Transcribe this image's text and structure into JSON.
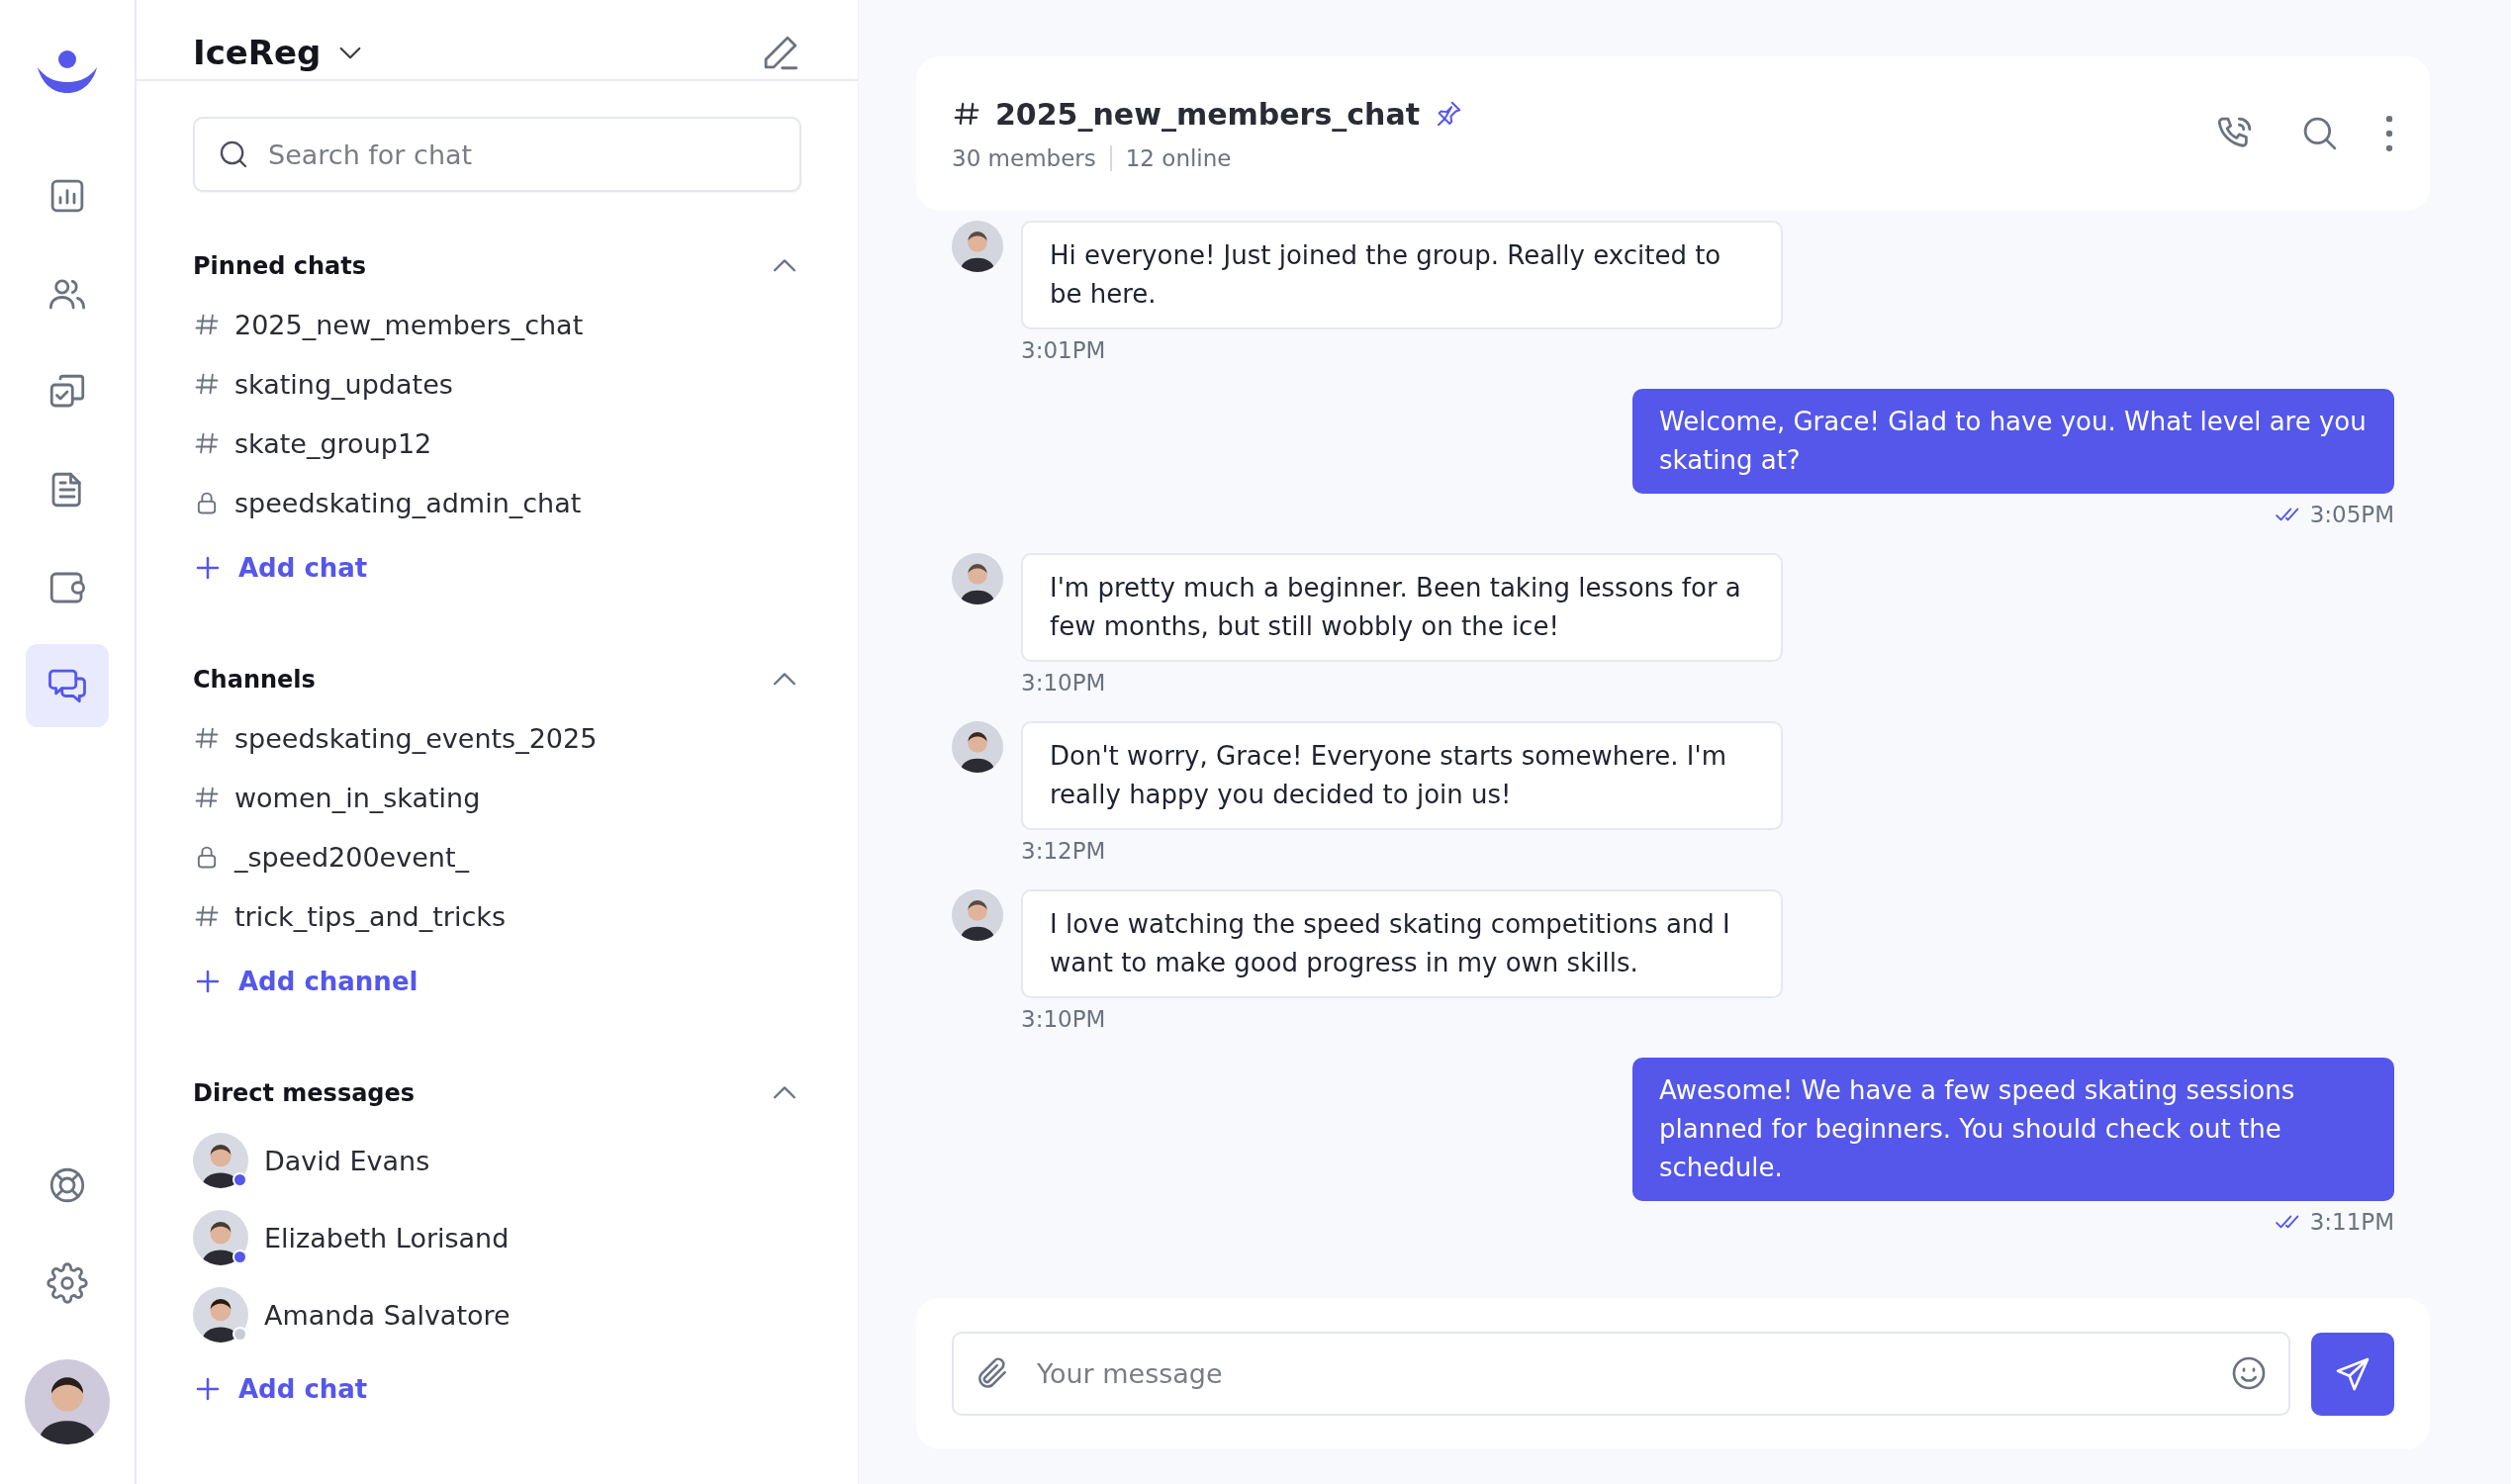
{
  "rail": [
    {
      "kind": "analytics",
      "selected": false
    },
    {
      "kind": "people",
      "selected": false
    },
    {
      "kind": "tasks",
      "selected": false
    },
    {
      "kind": "document",
      "selected": false
    },
    {
      "kind": "wallet",
      "selected": false
    },
    {
      "kind": "chat",
      "selected": true
    }
  ],
  "rail_bottom": [
    {
      "kind": "support"
    },
    {
      "kind": "settings"
    }
  ],
  "sidebar": {
    "workspace": "IceReg",
    "search": {
      "placeholder": "Search for chat"
    },
    "sections": [
      {
        "title": "Pinned chats",
        "expanded": true,
        "add_label": "Add chat",
        "items": [
          {
            "kind": "public",
            "name": "2025_new_members_chat"
          },
          {
            "kind": "public",
            "name": "skating_updates"
          },
          {
            "kind": "public",
            "name": "skate_group12"
          },
          {
            "kind": "private",
            "name": "speedskating_admin_chat"
          }
        ]
      },
      {
        "title": "Channels",
        "expanded": true,
        "add_label": "Add channel",
        "items": [
          {
            "kind": "public",
            "name": "speedskating_events_2025"
          },
          {
            "kind": "public",
            "name": "women_in_skating"
          },
          {
            "kind": "private",
            "name": "_speed200event_"
          },
          {
            "kind": "public",
            "name": "trick_tips_and_tricks"
          }
        ]
      },
      {
        "title": "Direct messages",
        "expanded": true,
        "add_label": "Add chat",
        "items": [
          {
            "kind": "person",
            "name": "David Evans",
            "online": true
          },
          {
            "kind": "person",
            "name": "Elizabeth Lorisand",
            "online": true
          },
          {
            "kind": "person",
            "name": "Amanda Salvatore",
            "online": false
          }
        ]
      }
    ]
  },
  "chat": {
    "title": "2025_new_members_chat",
    "pinned": true,
    "members": "30 members",
    "online": "12 online",
    "messages": [
      {
        "kind": "incoming",
        "text": "Hi everyone! Just joined the group. Really excited to be here.",
        "time": "3:01PM"
      },
      {
        "kind": "outgoing",
        "text": "Welcome, Grace! Glad to have you. What level are you skating at?",
        "time": "3:05PM",
        "read": true
      },
      {
        "kind": "incoming",
        "text": "I'm pretty much a beginner.  Been taking lessons for a few months, but still wobbly on the ice!",
        "time": "3:10PM"
      },
      {
        "kind": "incoming",
        "text": "Don't worry, Grace! Everyone starts somewhere. I'm really happy you decided to join us!",
        "time": "3:12PM"
      },
      {
        "kind": "incoming",
        "text": "I love watching the speed skating competitions and I want to make good progress in my own skills.",
        "time": "3:10PM"
      },
      {
        "kind": "outgoing",
        "text": "Awesome! We have a few speed skating sessions planned for beginners. You should check out the schedule.",
        "time": "3:11PM",
        "read": true
      }
    ],
    "composer": {
      "placeholder": "Your message"
    }
  }
}
